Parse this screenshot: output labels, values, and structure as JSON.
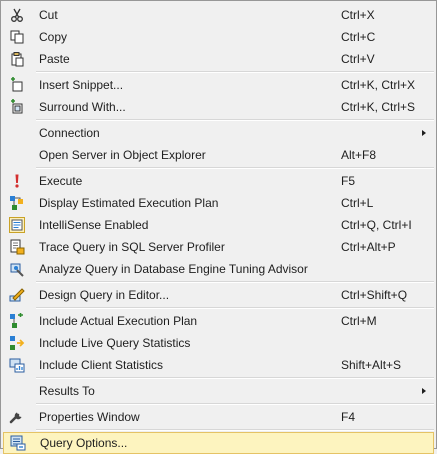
{
  "menu": {
    "groups": [
      [
        {
          "label": "Cut",
          "shortcut": "Ctrl+X",
          "icon": "scissors-icon"
        },
        {
          "label": "Copy",
          "shortcut": "Ctrl+C",
          "icon": "copy-icon"
        },
        {
          "label": "Paste",
          "shortcut": "Ctrl+V",
          "icon": "paste-icon"
        }
      ],
      [
        {
          "label": "Insert Snippet...",
          "shortcut": "Ctrl+K, Ctrl+X",
          "icon": "insert-snippet-icon"
        },
        {
          "label": "Surround With...",
          "shortcut": "Ctrl+K, Ctrl+S",
          "icon": "surround-with-icon"
        }
      ],
      [
        {
          "label": "Connection",
          "shortcut": "",
          "submenu": true
        },
        {
          "label": "Open Server in Object Explorer",
          "shortcut": "Alt+F8"
        }
      ],
      [
        {
          "label": "Execute",
          "shortcut": "F5",
          "icon": "execute-icon"
        },
        {
          "label": "Display Estimated Execution Plan",
          "shortcut": "Ctrl+L",
          "icon": "execution-plan-icon"
        },
        {
          "label": "IntelliSense Enabled",
          "shortcut": "Ctrl+Q, Ctrl+I",
          "icon": "intellisense-icon"
        },
        {
          "label": "Trace Query in SQL Server Profiler",
          "shortcut": "Ctrl+Alt+P",
          "icon": "profiler-icon"
        },
        {
          "label": "Analyze Query in Database Engine Tuning Advisor",
          "shortcut": "",
          "icon": "tuning-advisor-icon"
        }
      ],
      [
        {
          "label": "Design Query in Editor...",
          "shortcut": "Ctrl+Shift+Q",
          "icon": "design-query-icon"
        }
      ],
      [
        {
          "label": "Include Actual Execution Plan",
          "shortcut": "Ctrl+M",
          "icon": "actual-plan-icon"
        },
        {
          "label": "Include Live Query Statistics",
          "shortcut": "",
          "icon": "live-statistics-icon"
        },
        {
          "label": "Include Client Statistics",
          "shortcut": "Shift+Alt+S",
          "icon": "client-statistics-icon"
        }
      ],
      [
        {
          "label": "Results To",
          "shortcut": "",
          "submenu": true
        }
      ],
      [
        {
          "label": "Properties Window",
          "shortcut": "F4",
          "icon": "wrench-icon"
        }
      ],
      [
        {
          "label": "Query Options...",
          "shortcut": "",
          "icon": "query-options-icon",
          "highlighted": true
        }
      ]
    ]
  }
}
